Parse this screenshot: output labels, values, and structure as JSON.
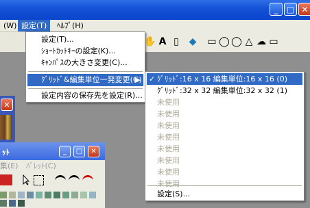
{
  "window": {
    "min": "_",
    "max": "□",
    "close": "✕"
  },
  "menubar": {
    "items": [
      {
        "label": "(W)"
      },
      {
        "label": "設定(T)"
      },
      {
        "label": "ﾍﾙﾌﾟ(H)"
      }
    ]
  },
  "toolbar": {
    "tools": [
      "✋",
      "A",
      "▯",
      "◆",
      "▭",
      "◯",
      "◯",
      "△",
      "☁",
      "▭"
    ]
  },
  "settings_menu": {
    "items": [
      {
        "label": "設定(T)..."
      },
      {
        "label": "ｼｮｰﾄｶｯﾄｷｰの設定(K)..."
      },
      {
        "label": "ｷｬﾝﾊﾟｽの大きさ変更(C)..."
      },
      {
        "label": "ｸﾞﾘｯﾄﾞ&編集単位一発変更(G)",
        "arrow": "▶"
      },
      {
        "label": "設定内容の保存先を設定(R)..."
      }
    ]
  },
  "grid_submenu": {
    "items": [
      {
        "label": "ｸﾞﾘｯﾄﾞ:16 x 16  編集単位:16 x 16 (0)",
        "check": "✓"
      },
      {
        "label": "ｸﾞﾘｯﾄﾞ:32 x 32  編集単位:32 x 32 (1)"
      },
      {
        "label": "未使用"
      },
      {
        "label": "未使用"
      },
      {
        "label": "未使用"
      },
      {
        "label": "未使用"
      },
      {
        "label": "未使用"
      },
      {
        "label": "未使用"
      },
      {
        "label": "未使用"
      },
      {
        "label": "未使用"
      },
      {
        "label": "設定(S)..."
      }
    ]
  },
  "palette_window": {
    "title": "ｯﾄ",
    "menu": [
      "集(E)",
      "ﾊﾟﾚｯﾄ(C)"
    ],
    "buttons": {
      "min": "_",
      "max": "□",
      "close": "✕"
    }
  },
  "left_window": {
    "close": "✕"
  },
  "colors": {
    "titlebar": "#1553d8",
    "highlight": "#316ac5",
    "workspace": "#8e8f8e"
  }
}
